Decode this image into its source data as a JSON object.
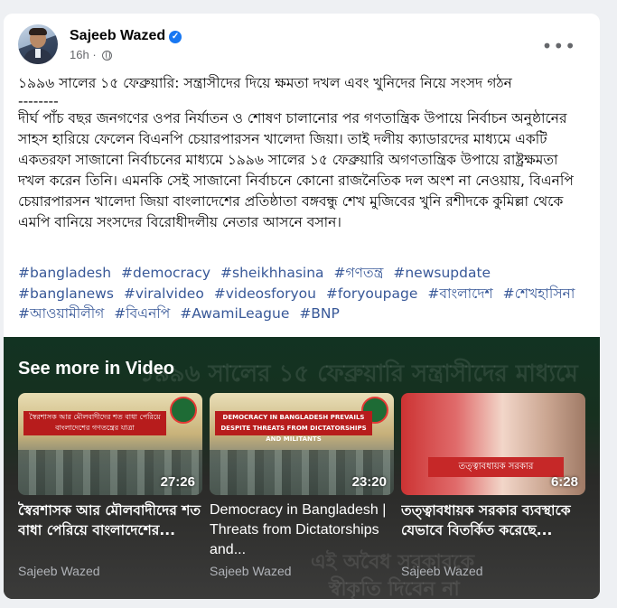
{
  "post": {
    "author": "Sajeeb Wazed",
    "time": "16h",
    "visibility_icon": "globe-icon",
    "more_icon": "more-options-icon",
    "headline": "১৯৯৬ সালের ১৫ ফেব্রুয়ারি: সন্ত্রাসীদের দিয়ে ক্ষমতা দখল এবং খুনিদের নিয়ে সংসদ গঠন",
    "divider": "--------",
    "body": "দীর্ঘ পাঁচ বছর জনগণের ওপর নির্যাতন ও শোষণ চালানোর পর গণতান্ত্রিক উপায়ে নির্বাচন অনুষ্ঠানের সাহস হারিয়ে ফেলেন বিএনপি চেয়ারপারসন খালেদা জিয়া। তাই দলীয় ক্যাডারদের মাধ্যমে একটি একতরফা সাজানো নির্বাচনের মাধ্যমে ১৯৯৬ সালের ১৫ ফেব্রুয়ারি অগণতান্ত্রিক উপায়ে রাষ্ট্রক্ষমতা দখল করেন তিনি। এমনকি সেই সাজানো নির্বাচনে কোনো রাজনৈতিক দল অংশ না নেওয়ায়, বিএনপি চেয়ারপারসন খালেদা জিয়া বাংলাদেশের প্রতিষ্ঠাতা বঙ্গবন্ধু শেখ মুজিবের খুনি রশীদকে কুমিল্লা থেকে এমপি বানিয়ে সংসদের বিরোধীদলীয় নেতার আসনে বসান।",
    "hashtags": [
      "#bangladesh",
      "#democracy",
      "#sheikhhasina",
      "#গণতন্ত্র",
      "#newsupdate",
      "#banglanews",
      "#viralvideo",
      "#videosforyou",
      "#foryoupage",
      "#বাংলাদেশ",
      "#শেখহাসিনা",
      "#আওয়ামীলীগ",
      "#বিএনপি",
      "#AwamiLeague",
      "#BNP"
    ]
  },
  "video_section": {
    "heading": "See more in Video",
    "background_text": [
      "১৯৯৬ সালের ১৫ ফেব্রুয়ারি সন্ত্রাসীদের মাধ্যমে",
      "এই অবৈধ সরকারকে",
      "স্বীকৃতি দিবেন না"
    ],
    "videos": [
      {
        "title": "স্বৈরশাসক আর মৌলবাদীদের শত বাধা পেরিয়ে বাংলাদেশের...",
        "duration": "27:26",
        "author": "Sajeeb Wazed",
        "thumb_banner": "স্বৈরশাসক আর মৌলবাদীদের শত বাধা পেরিয়ে বাংলাদেশের গণতন্ত্রের যাত্রা"
      },
      {
        "title": "Democracy in Bangladesh | Threats from Dictatorships and...",
        "duration": "23:20",
        "author": "Sajeeb Wazed",
        "thumb_banner": "DEMOCRACY IN BANGLADESH PREVAILS DESPITE THREATS FROM DICTATORSHIPS AND MILITANTS"
      },
      {
        "title": "তত্ত্বাবধায়ক সরকার ব্যবস্থাকে যেভাবে বিতর্কিত করেছে...",
        "duration": "6:28",
        "author": "Sajeeb Wazed",
        "thumb_banner": "তত্ত্বাবধায়ক সরকার"
      }
    ]
  },
  "colors": {
    "hashtag": "#385898",
    "verified": "#1877f2",
    "video_bg": "#17301f"
  }
}
